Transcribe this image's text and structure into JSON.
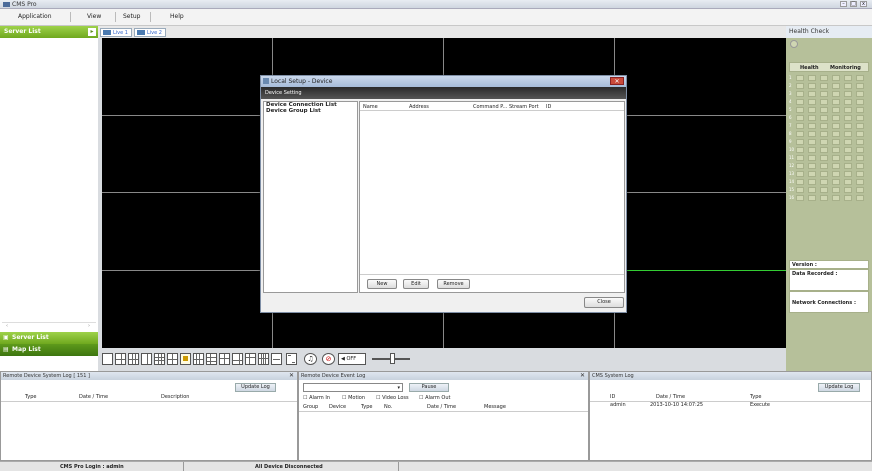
{
  "app": {
    "title": "CMS Pro"
  },
  "menu": {
    "items": [
      "Application",
      "View",
      "Setup",
      "Help"
    ]
  },
  "left_panel": {
    "header": "Server List",
    "server_list_label": "Server List",
    "map_list_label": "Map List"
  },
  "tabs": [
    "Live 1",
    "Live 2"
  ],
  "health": {
    "header": "Health Check",
    "columns": [
      "Health",
      "Monitoring"
    ],
    "rows": [
      "1",
      "2",
      "3",
      "4",
      "5",
      "6",
      "7",
      "8",
      "9",
      "10",
      "11",
      "12",
      "13",
      "14",
      "15",
      "16"
    ],
    "version_label": "Version :",
    "data_recorded_label": "Data Recorded :",
    "network_label": "Network Connections :"
  },
  "dialog": {
    "title": "Local Setup - Device",
    "subtitle": "Device Setting",
    "close_x": "✕",
    "nav": [
      "Device Connection List",
      "Device Group List"
    ],
    "columns": [
      "Name",
      "Address",
      "Command P...",
      "Stream Port",
      "ID"
    ],
    "buttons": {
      "new": "New",
      "edit": "Edit",
      "remove": "Remove",
      "close": "Close"
    }
  },
  "toolbar": {
    "off_label": "OFF"
  },
  "logs": {
    "system_log": {
      "title": "Remote Device System Log [ 151 ]",
      "update_label": "Update Log",
      "columns": [
        "Type",
        "Date / Time",
        "Description"
      ]
    },
    "event_log": {
      "title": "Remote Device Event Log",
      "pause_label": "Pause",
      "filters": [
        "Alarm In",
        "Motion",
        "Video Loss",
        "Alarm Out"
      ],
      "columns": [
        "Group",
        "Device",
        "Type",
        "No.",
        "Date / Time",
        "Message"
      ]
    },
    "cms_log": {
      "title": "CMS System Log",
      "update_label": "Update Log",
      "columns": [
        "ID",
        "Date / Time",
        "Type"
      ],
      "rows": [
        {
          "id": "admin",
          "datetime": "2013-10-10 14:07:25",
          "type": "Execute"
        }
      ]
    },
    "close_x": "✕"
  },
  "status": {
    "login": "CMS Pro Login : admin",
    "connection": "All Device Disconnected"
  }
}
